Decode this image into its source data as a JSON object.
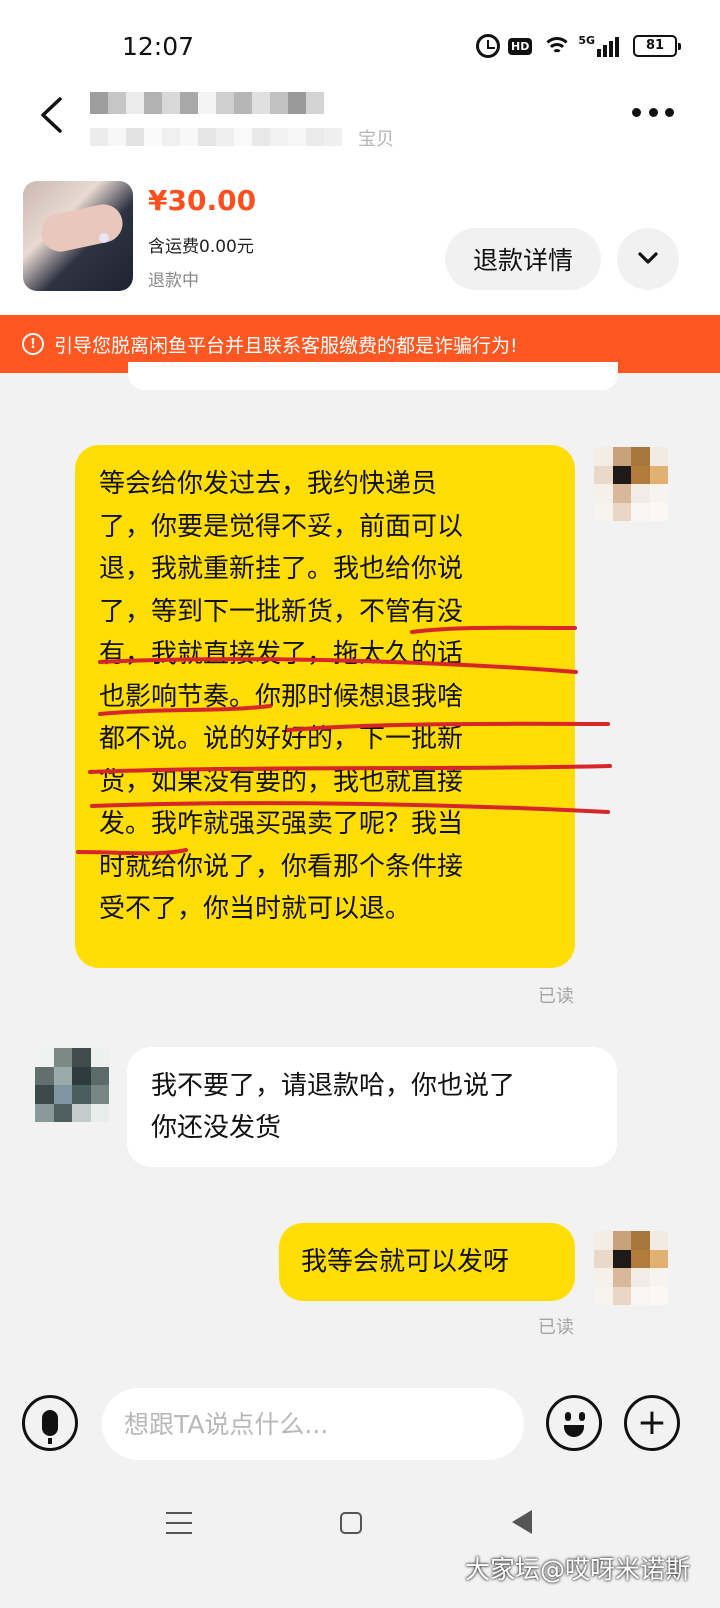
{
  "status_bar": {
    "time": "12:07",
    "hd_label": "HD",
    "network_label": "5G",
    "battery": "81",
    "icons": [
      "alarm-icon",
      "hd-icon",
      "wifi-icon",
      "signal-icon",
      "battery-icon"
    ]
  },
  "header": {
    "seller_subtitle_tail": "宝贝",
    "icons": [
      "chevron-left-icon",
      "more-dots-icon"
    ]
  },
  "product": {
    "price": "¥30.00",
    "shipping": "含运费0.00元",
    "status": "退款中",
    "refund_button": "退款详情",
    "icons": [
      "chevron-down-icon"
    ]
  },
  "warning_banner": {
    "icon": "alert-circle-icon",
    "text": "引导您脱离闲鱼平台并且联系客服缴费的都是诈骗行为!"
  },
  "messages": [
    {
      "side": "right",
      "lines": [
        "等会给你发过去，我约快递员",
        "了，你要是觉得不妥，前面可以",
        "退，我就重新挂了。我也给你说",
        "了，等到下一批新货，不管有没",
        "有，我就直接发了，拖太久的话",
        "也影响节奏。你那时候想退我啥",
        "都不说。说的好好的，下一批新",
        "货，如果没有要的，我也就直接",
        "发。我咋就强买强卖了呢？我当",
        "时就给你说了，你看那个条件接",
        "受不了，你当时就可以退。"
      ],
      "read_label": "已读"
    },
    {
      "side": "left",
      "lines": [
        "我不要了，请退款哈，你也说了",
        "你还没发货"
      ]
    },
    {
      "side": "right",
      "lines": [
        "我等会就可以发呀"
      ],
      "read_label": "已读"
    }
  ],
  "input_bar": {
    "placeholder": "想跟TA说点什么...",
    "value": "",
    "icons": [
      "microphone-icon",
      "emoji-icon",
      "plus-icon"
    ]
  },
  "nav_bar": {
    "icons": [
      "menu-icon",
      "home-icon",
      "back-triangle-icon"
    ]
  },
  "watermark": "大家坛@哎呀米诺斯",
  "colors": {
    "accent_orange": "#ff5722",
    "price_orange": "#ff4f1f",
    "bubble_yellow": "#ffdd05",
    "ink_red": "#d7262a",
    "background": "#f2f2f2"
  }
}
